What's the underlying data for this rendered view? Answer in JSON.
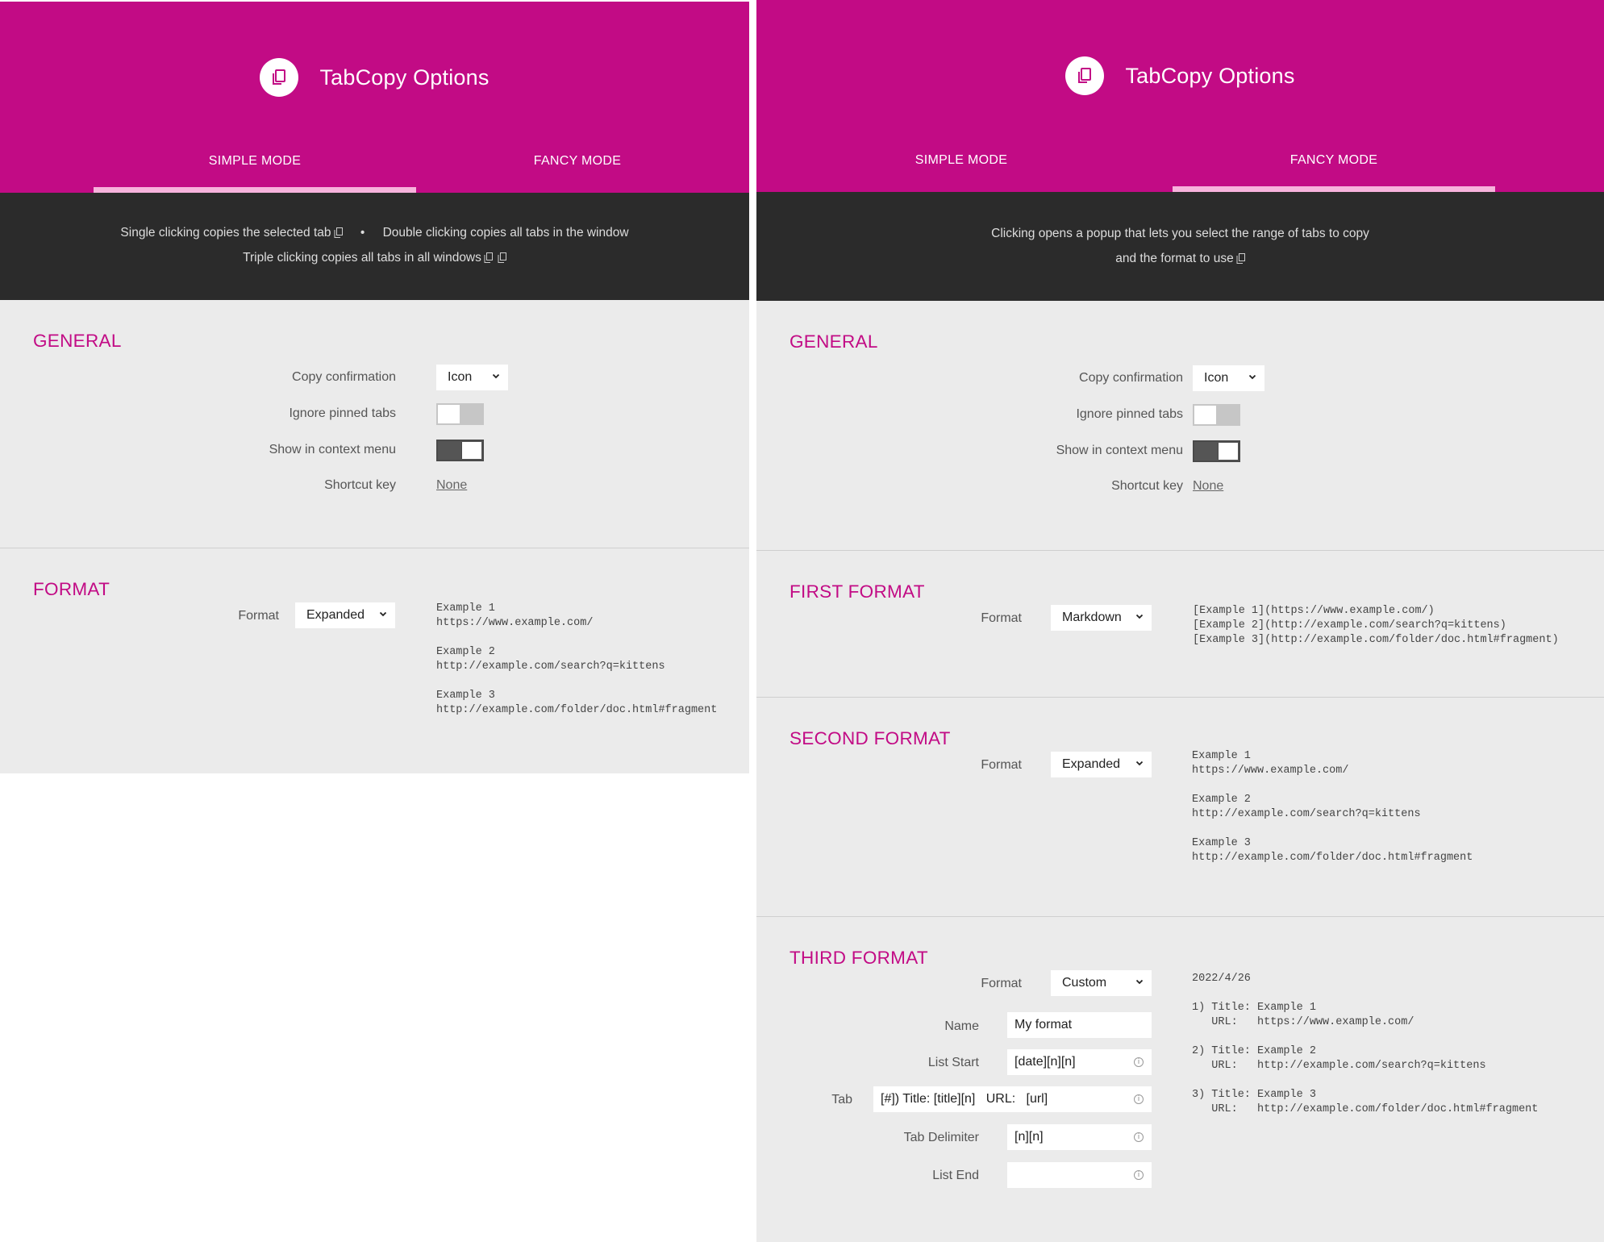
{
  "app_title": "TabCopy Options",
  "tabs": {
    "simple": "SIMPLE MODE",
    "fancy": "FANCY MODE"
  },
  "left": {
    "info_line1_a": "Single clicking copies the selected tab",
    "info_bullet": "•",
    "info_line1_b": "Double clicking copies all tabs in the window",
    "info_line2": "Triple clicking copies all tabs in all windows"
  },
  "right": {
    "info_line1": "Clicking opens a popup that lets you select the range of tabs to copy",
    "info_line2": "and the format to use"
  },
  "general": {
    "title": "GENERAL",
    "copy_confirmation_label": "Copy confirmation",
    "copy_confirmation_value": "Icon",
    "ignore_pinned_label": "Ignore pinned tabs",
    "ignore_pinned_on": false,
    "context_menu_label": "Show in context menu",
    "context_menu_on": true,
    "shortcut_label": "Shortcut key",
    "shortcut_value": "None"
  },
  "format_labels": {
    "format": "Format",
    "name": "Name",
    "list_start": "List Start",
    "tab": "Tab",
    "tab_delimiter": "Tab Delimiter",
    "list_end": "List End"
  },
  "left_format": {
    "title": "FORMAT",
    "value": "Expanded",
    "preview": "Example 1\nhttps://www.example.com/\n\nExample 2\nhttp://example.com/search?q=kittens\n\nExample 3\nhttp://example.com/folder/doc.html#fragment"
  },
  "first_format": {
    "title": "FIRST FORMAT",
    "value": "Markdown",
    "preview": "[Example 1](https://www.example.com/)\n[Example 2](http://example.com/search?q=kittens)\n[Example 3](http://example.com/folder/doc.html#fragment)"
  },
  "second_format": {
    "title": "SECOND FORMAT",
    "value": "Expanded",
    "preview": "Example 1\nhttps://www.example.com/\n\nExample 2\nhttp://example.com/search?q=kittens\n\nExample 3\nhttp://example.com/folder/doc.html#fragment"
  },
  "third_format": {
    "title": "THIRD FORMAT",
    "value": "Custom",
    "name_value": "My format",
    "list_start_value": "[date][n][n]",
    "tab_value": "[#]) Title: [title][n]   URL:   [url]",
    "tab_delimiter_value": "[n][n]",
    "list_end_value": "",
    "info_glyph": "i",
    "preview": "2022/4/26\n\n1) Title: Example 1\n   URL:   https://www.example.com/\n\n2) Title: Example 2\n   URL:   http://example.com/search?q=kittens\n\n3) Title: Example 3\n   URL:   http://example.com/folder/doc.html#fragment"
  },
  "icons": {
    "logo": "copy-icon",
    "select_arrow": "chevron-down-icon",
    "field_hint": "info-icon"
  },
  "colors": {
    "brand": "#c20b85",
    "tab_indicator": "#f7b3dc",
    "info_bar": "#2b2b2b",
    "content_bg": "#ebebeb"
  }
}
